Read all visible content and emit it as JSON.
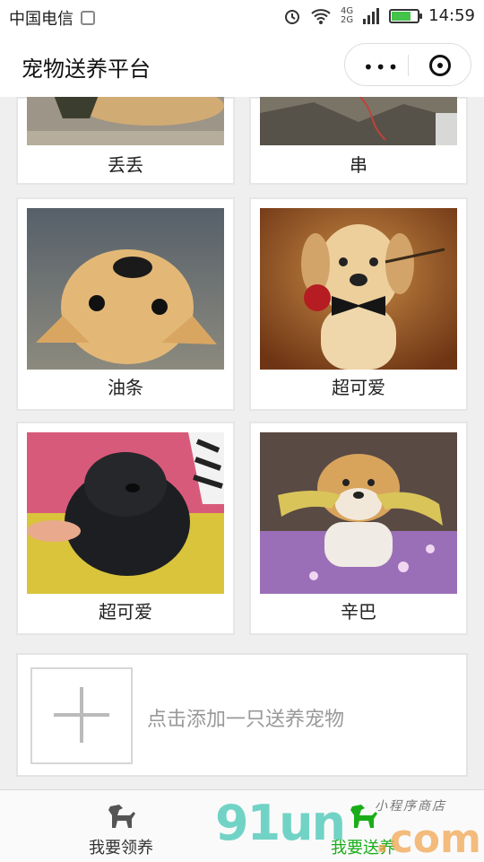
{
  "status": {
    "carrier": "中国电信",
    "network_top": "4G",
    "network_bottom": "2G",
    "time": "14:59",
    "battery_fraction": 0.75
  },
  "navbar": {
    "title": "宠物送养平台"
  },
  "pets": [
    {
      "name": "丢丢"
    },
    {
      "name": "串"
    },
    {
      "name": "油条"
    },
    {
      "name": "超可爱"
    },
    {
      "name": "超可爱"
    },
    {
      "name": "辛巴"
    }
  ],
  "add_card": {
    "text": "点击添加一只送养宠物"
  },
  "tabs": [
    {
      "label": "我要领养",
      "icon": "dog-icon"
    },
    {
      "label": "我要送养",
      "icon": "green-dog-icon"
    }
  ],
  "watermark": {
    "brand_left": "91un",
    "brand_right": ".com",
    "subtitle": "小程序商店"
  },
  "colors": {
    "accent": "#1aad19",
    "battery": "#44c24a"
  }
}
